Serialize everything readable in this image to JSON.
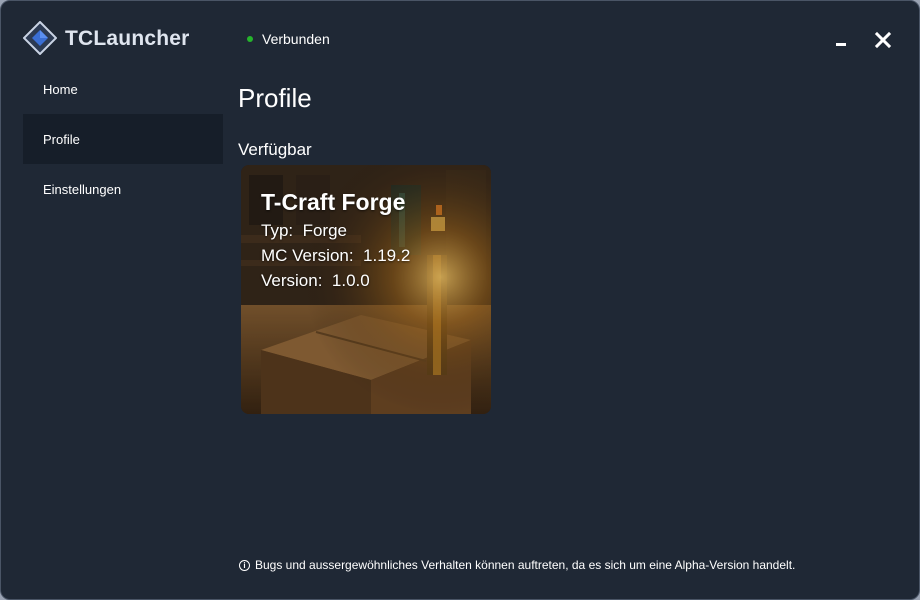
{
  "app": {
    "title": "TCLauncher"
  },
  "status": {
    "text": "Verbunden",
    "color": "#25b42c"
  },
  "window_controls": {
    "minimize": "minimize",
    "close": "close"
  },
  "sidebar": {
    "items": [
      {
        "label": "Home",
        "active": false
      },
      {
        "label": "Profile",
        "active": true
      },
      {
        "label": "Einstellungen",
        "active": false
      }
    ]
  },
  "main": {
    "title": "Profile",
    "section": "Verfügbar",
    "profiles": [
      {
        "name": "T-Craft Forge",
        "type_label": "Typ:",
        "type_value": "Forge",
        "mc_label": "MC Version:",
        "mc_value": "1.19.2",
        "version_label": "Version:",
        "version_value": "1.0.0"
      }
    ]
  },
  "footer": {
    "icon": "info-icon",
    "text": "Bugs und aussergewöhnliches Verhalten können auftreten, da es sich um eine Alpha-Version handelt."
  },
  "colors": {
    "background": "#1f2835",
    "sidebar_active": "#161e29",
    "accent": "#3b6fd4"
  }
}
